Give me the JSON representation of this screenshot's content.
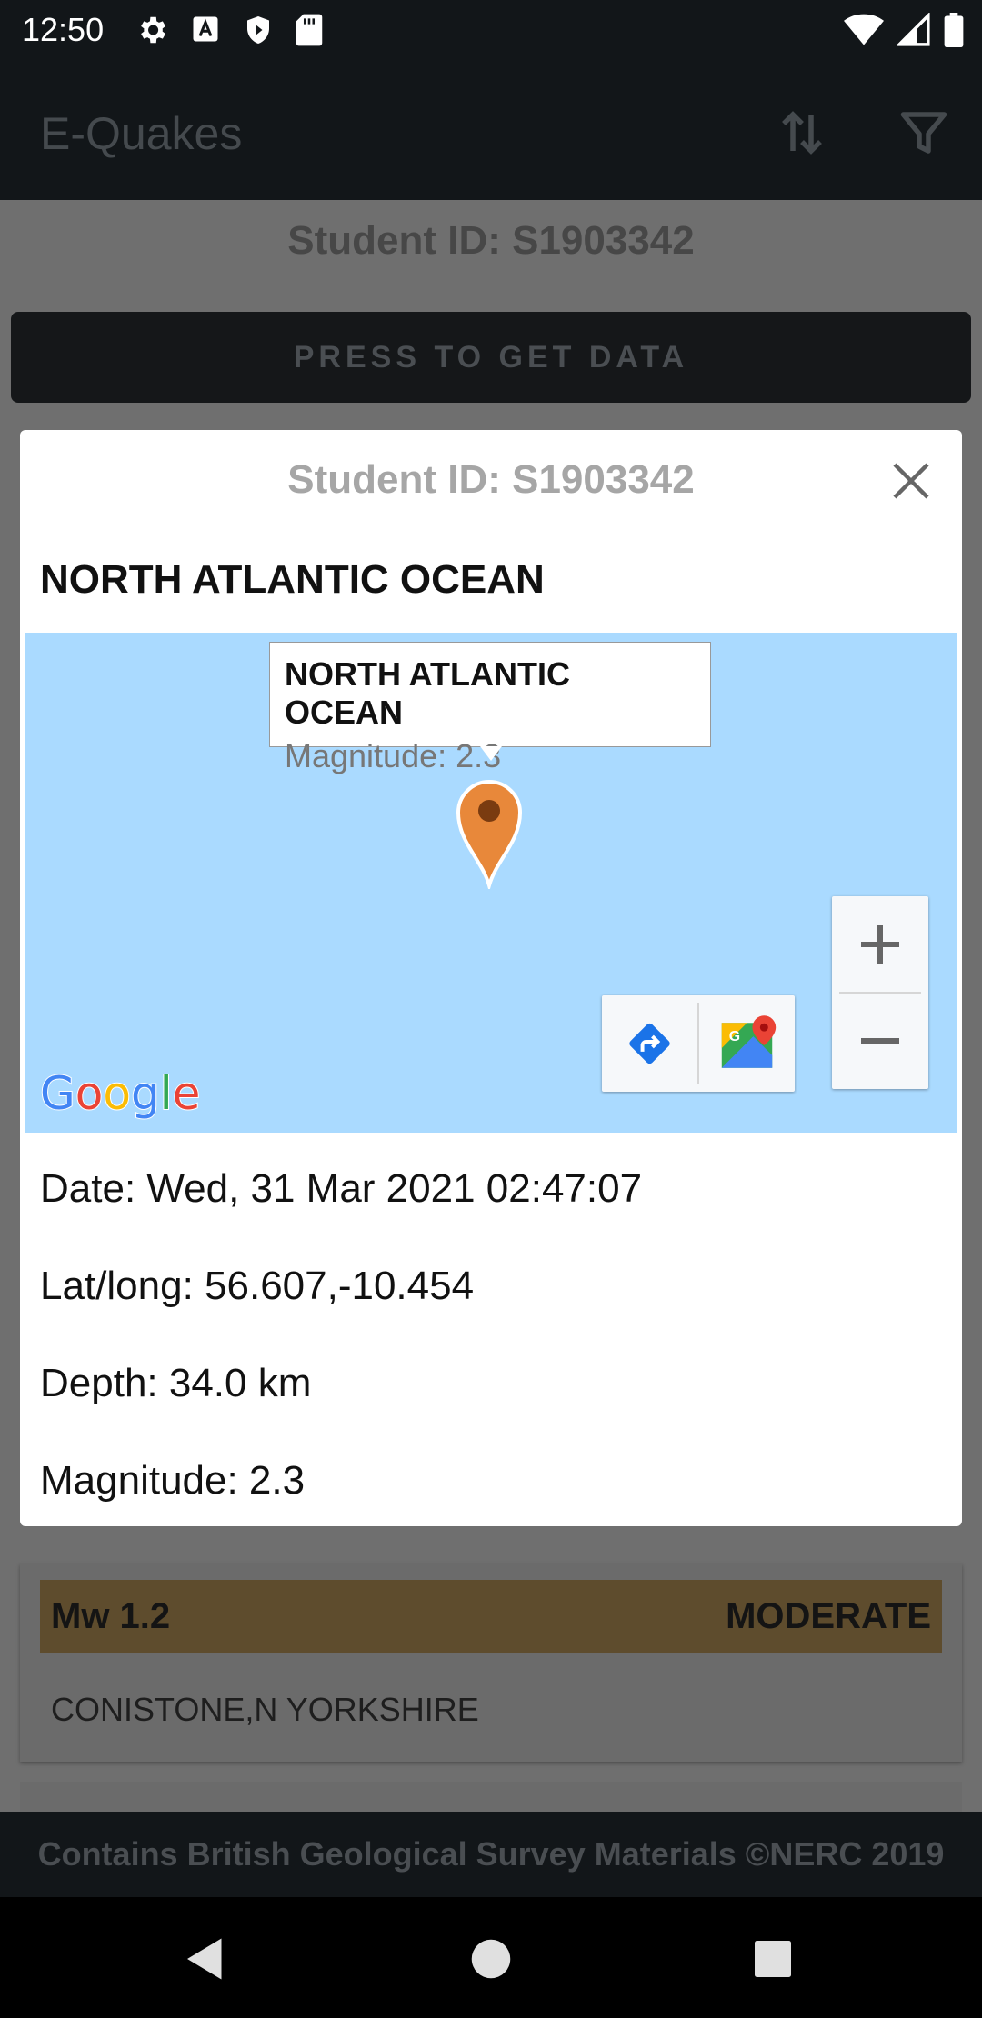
{
  "status_bar": {
    "time": "12:50"
  },
  "app_bar": {
    "title": "E-Quakes"
  },
  "background": {
    "student_id": "Student ID: S1903342",
    "get_data_button": "PRESS TO GET DATA",
    "card": {
      "magnitude": "Mw 1.2",
      "severity": "MODERATE",
      "location": "CONISTONE,N YORKSHIRE",
      "severity_bar_color": "#5e4c2d"
    }
  },
  "dialog": {
    "title": "Student ID: S1903342",
    "location_title": "NORTH ATLANTIC OCEAN",
    "map": {
      "info_title": "NORTH ATLANTIC OCEAN",
      "info_magnitude": "Magnitude: 2.3",
      "water_color": "#aadaff",
      "marker_color": "#e8883a",
      "logo_letters": [
        "G",
        "o",
        "o",
        "g",
        "l",
        "e"
      ]
    },
    "details": {
      "date": "Date: Wed, 31 Mar 2021 02:47:07",
      "latlong": "Lat/long: 56.607,-10.454",
      "depth": "Depth: 34.0 km",
      "magnitude": "Magnitude: 2.3"
    }
  },
  "footer": {
    "text": "Contains British Geological Survey Materials ©NERC 2019"
  }
}
